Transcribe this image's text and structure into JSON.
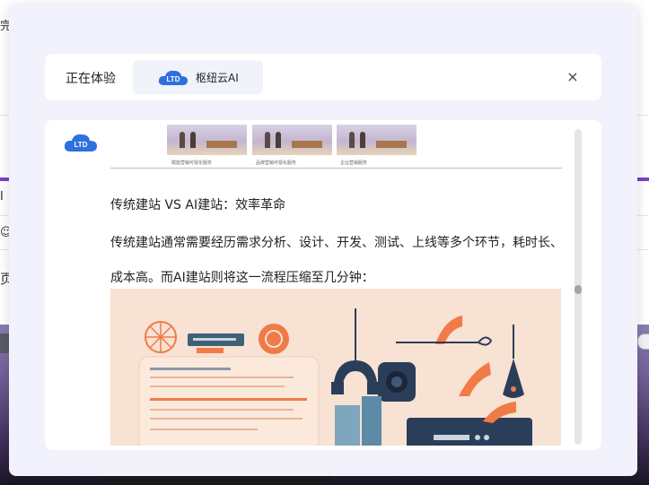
{
  "background": {
    "fragments": [
      "完",
      "I",
      "☺",
      "页面"
    ]
  },
  "modal": {
    "header_label": "正在体验",
    "app_name": "枢纽云AI",
    "close_symbol": "×",
    "logo_icon": "cloud-logo-icon"
  },
  "article": {
    "thumb_captions": [
      "赋能营销可视化服务",
      "品牌营销可视化服务",
      "企业营销服务"
    ],
    "heading": "传统建站 VS AI建站：效率革命",
    "paragraph_line1": "传统建站通常需要经历需求分析、设计、开发、测试、上线等多个环节，耗时长、",
    "paragraph_line2": "成本高。而AI建站则将这一流程压缩至几分钟："
  },
  "colors": {
    "accent_purple": "#7a3fc6",
    "logo_blue": "#2f6fde",
    "illustration_bg": "#f7e2d3",
    "illustration_orange": "#f07b47",
    "illustration_navy": "#2b3e59"
  }
}
